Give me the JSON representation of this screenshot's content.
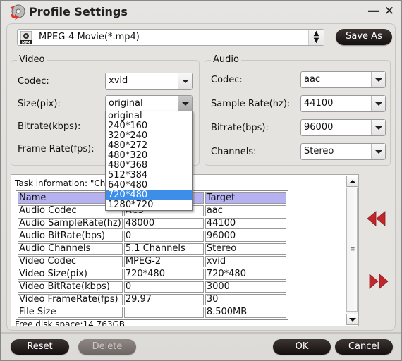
{
  "window": {
    "title": "Profile Settings",
    "minimize_label": "—",
    "close_label": "✕"
  },
  "profile": {
    "selected": "MPEG-4 Movie(*.mp4)",
    "icon": "mp4-file-icon",
    "icon_text": "MP4",
    "save_as_label": "Save As"
  },
  "video": {
    "group_label": "Video",
    "codec_label": "Codec:",
    "codec_value": "xvid",
    "size_label": "Size(pix):",
    "size_value": "original",
    "bitrate_label": "Bitrate(kbps):",
    "framerate_label": "Frame Rate(fps):",
    "size_options": [
      "original",
      "240*160",
      "320*240",
      "480*272",
      "480*320",
      "480*368",
      "512*384",
      "640*480",
      "720*480",
      "1280*720"
    ],
    "size_highlighted": "720*480"
  },
  "audio": {
    "group_label": "Audio",
    "codec_label": "Codec:",
    "codec_value": "aac",
    "samplerate_label": "Sample Rate(hz):",
    "samplerate_value": "44100",
    "bitrate_label": "Bitrate(bps):",
    "bitrate_value": "96000",
    "channels_label": "Channels:",
    "channels_value": "Stereo"
  },
  "task": {
    "info_label": "Task information: \"Ch",
    "columns": [
      "Name",
      "",
      "Target"
    ],
    "rows": [
      [
        "Audio Codec",
        "AC3",
        "aac"
      ],
      [
        "Audio SampleRate(hz)",
        "48000",
        "44100"
      ],
      [
        "Audio BitRate(bps)",
        "0",
        "96000"
      ],
      [
        "Audio Channels",
        "5.1 Channels",
        "Stereo"
      ],
      [
        "Video Codec",
        "MPEG-2",
        "xvid"
      ],
      [
        "Video Size(pix)",
        "720*480",
        "720*480"
      ],
      [
        "Video BitRate(kbps)",
        "0",
        "3000"
      ],
      [
        "Video FrameRate(fps)",
        "29.97",
        "30"
      ],
      [
        "File Size",
        "",
        "8.500MB"
      ]
    ],
    "free_disk": "Free disk space:14.763GB"
  },
  "buttons": {
    "reset": "Reset",
    "delete": "Delete",
    "ok": "OK",
    "cancel": "Cancel"
  },
  "colors": {
    "header_row": "#b6b1f0",
    "selection": "#3d8ee9",
    "arrow_red": "#c0272d",
    "button_dark": "#1e1817"
  }
}
